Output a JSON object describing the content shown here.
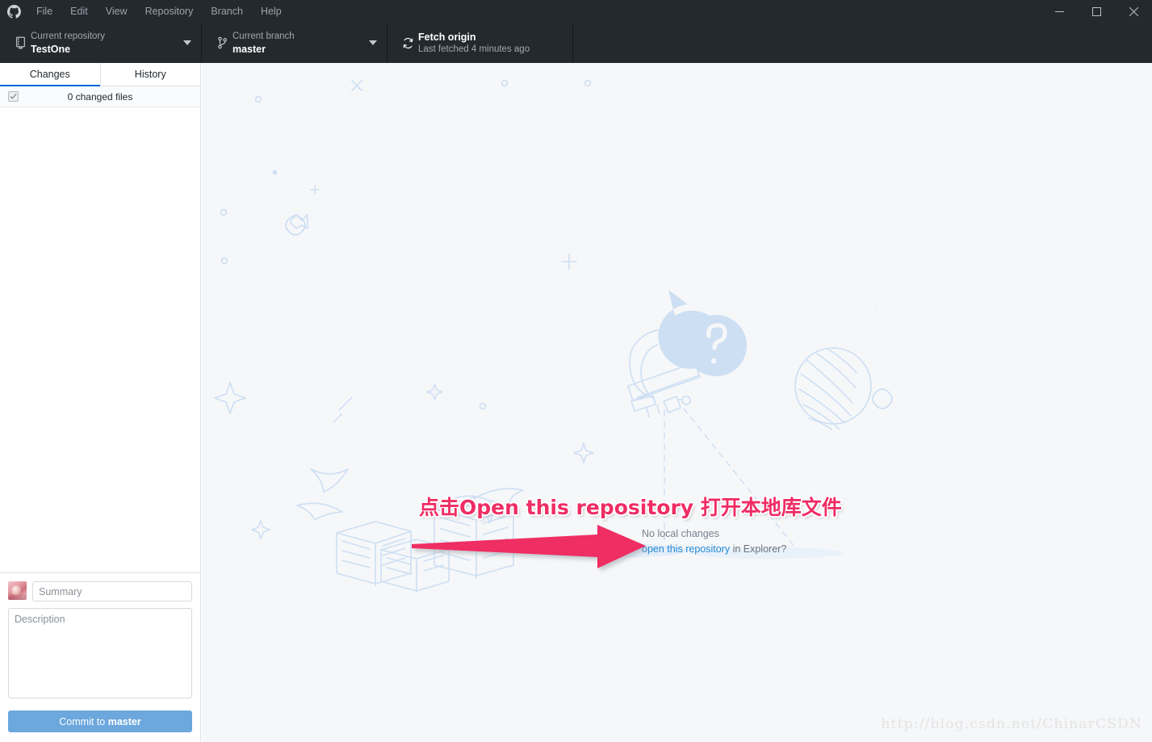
{
  "window": {
    "app_logo": "github-mark-icon",
    "menu": [
      "File",
      "Edit",
      "View",
      "Repository",
      "Branch",
      "Help"
    ],
    "controls": {
      "minimize": "–",
      "maximize": "□",
      "close": "✕"
    }
  },
  "toolbar": {
    "repository": {
      "label": "Current repository",
      "value": "TestOne",
      "icon": "repo-book-icon"
    },
    "branch": {
      "label": "Current branch",
      "value": "master",
      "icon": "git-branch-icon"
    },
    "fetch": {
      "label": "Fetch origin",
      "value": "Last fetched 4 minutes ago",
      "icon": "sync-refresh-icon"
    }
  },
  "sidebar": {
    "tabs": [
      {
        "label": "Changes",
        "active": true
      },
      {
        "label": "History",
        "active": false
      }
    ],
    "files_header": {
      "checkbox_state": "checked-disabled",
      "count_label": "0 changed files"
    },
    "commit": {
      "avatar": "user-avatar",
      "summary_placeholder": "Summary",
      "summary_value": "",
      "description_placeholder": "Description",
      "description_value": "",
      "commit_button_prefix": "Commit to ",
      "commit_button_branch": "master"
    }
  },
  "main": {
    "empty_state": {
      "illustration": "telescope-searching-illustration",
      "line1": "No local changes",
      "link_text": "open this repository",
      "line2_suffix": " in Explorer?"
    }
  },
  "annotation": {
    "text_cn_prefix": "点击",
    "text_en": "Open this repository",
    "text_cn_suffix": " 打开本地库文件",
    "color": "#ef2d64",
    "arrow": "right-arrow-annotation"
  },
  "watermark": {
    "text": "http://blog.csdn.net/ChinarCSDN"
  },
  "colors": {
    "titlebar_bg": "#24292e",
    "sidebar_bg": "#ffffff",
    "main_bg": "#f6f7f9",
    "accent_blue": "#0366d6",
    "link_blue": "#2188d6",
    "commit_button": "#6ca7dd",
    "illustration": "#cddff3",
    "annotation_pink": "#ef2d64"
  }
}
